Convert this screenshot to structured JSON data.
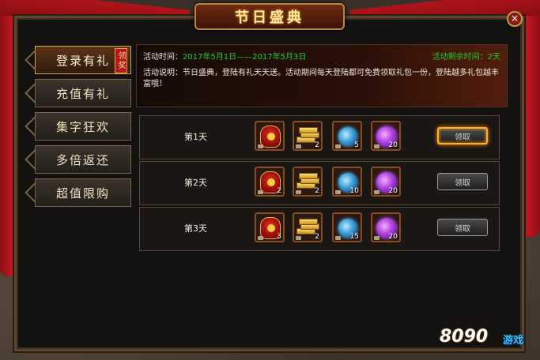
{
  "window": {
    "title": "节日盛典",
    "close": "×"
  },
  "sidebar": {
    "items": [
      {
        "label": "登录有礼",
        "active": true,
        "tag": "领奖"
      },
      {
        "label": "充值有礼"
      },
      {
        "label": "集字狂欢"
      },
      {
        "label": "多倍返还"
      },
      {
        "label": "超值限购"
      }
    ]
  },
  "info": {
    "time_label": "活动时间：",
    "time_value": "2017年5月1日——2017年5月3日",
    "remaining_label": "活动剩余时间：",
    "remaining_value": "2天",
    "desc": "活动说明：节日盛典，登陆有礼天天送。活动期间每天登陆都可免费领取礼包一份，登陆越多礼包越丰富哦！"
  },
  "rewards": [
    {
      "day": "第1天",
      "items": {
        "red": "",
        "gold": "2",
        "blue": "5",
        "purple": "20"
      },
      "button": "领取",
      "highlight": true
    },
    {
      "day": "第2天",
      "items": {
        "red": "2",
        "gold": "2",
        "blue": "10",
        "purple": "20"
      },
      "button": "领取",
      "highlight": false
    },
    {
      "day": "第3天",
      "items": {
        "red": "3",
        "gold": "2",
        "blue": "15",
        "purple": "20"
      },
      "button": "领取",
      "highlight": false
    }
  ],
  "watermark": {
    "num": "8090",
    "text": "游戏"
  },
  "icons": [
    "close-icon",
    "sidebar-arrow-icon",
    "red-token-icon",
    "gold-bar-icon",
    "blue-orb-icon",
    "purple-orb-icon",
    "lock-icon"
  ]
}
